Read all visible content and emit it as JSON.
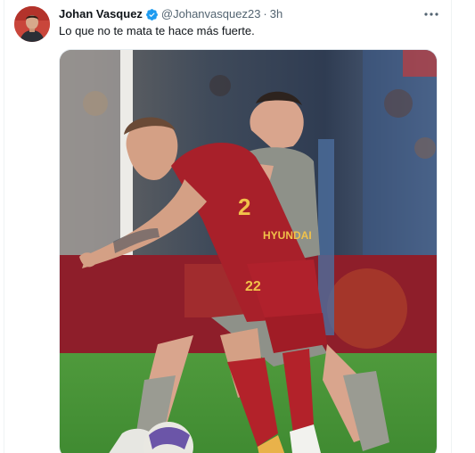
{
  "tweet": {
    "author": {
      "display_name": "Johan Vasquez",
      "handle": "@Johanvasquez23",
      "verified": true
    },
    "separator": "·",
    "time": "3h",
    "text": "Lo que no te mata te hace más fuerte.",
    "media": {
      "kit_sponsor": "HYUNDAI",
      "shirt_number": "22"
    }
  },
  "icons": {
    "verified": "verified-badge-icon",
    "more": "more-options-icon"
  },
  "colors": {
    "verified_blue": "#1d9bf0",
    "text_primary": "#0f1419",
    "text_secondary": "#536471"
  }
}
